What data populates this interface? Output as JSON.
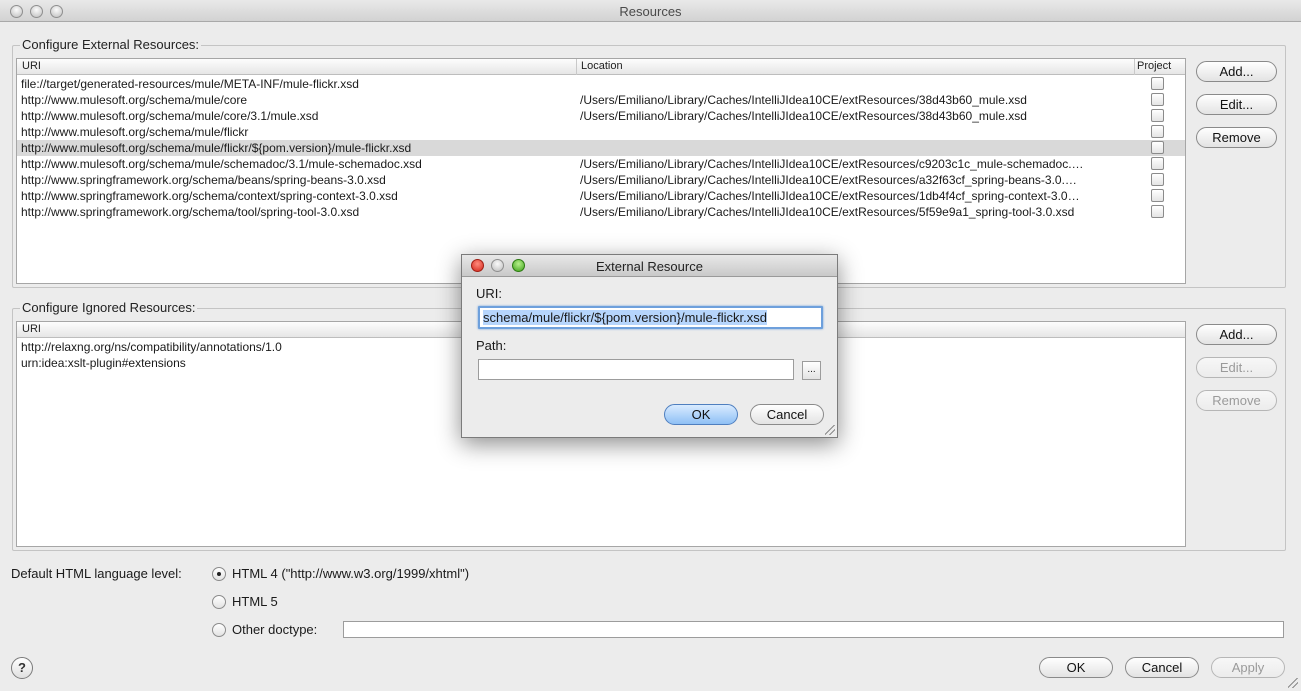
{
  "window": {
    "title": "Resources"
  },
  "external": {
    "group_label": "Configure External Resources:",
    "columns": {
      "uri": "URI",
      "location": "Location",
      "project": "Project"
    },
    "rows": [
      {
        "uri": "file://target/generated-resources/mule/META-INF/mule-flickr.xsd",
        "location": "",
        "project": false,
        "selected": false
      },
      {
        "uri": "http://www.mulesoft.org/schema/mule/core",
        "location": "/Users/Emiliano/Library/Caches/IntelliJIdea10CE/extResources/38d43b60_mule.xsd",
        "project": false,
        "selected": false
      },
      {
        "uri": "http://www.mulesoft.org/schema/mule/core/3.1/mule.xsd",
        "location": "/Users/Emiliano/Library/Caches/IntelliJIdea10CE/extResources/38d43b60_mule.xsd",
        "project": false,
        "selected": false
      },
      {
        "uri": "http://www.mulesoft.org/schema/mule/flickr",
        "location": "",
        "project": false,
        "selected": false
      },
      {
        "uri": "http://www.mulesoft.org/schema/mule/flickr/${pom.version}/mule-flickr.xsd",
        "location": "",
        "project": false,
        "selected": true
      },
      {
        "uri": "http://www.mulesoft.org/schema/mule/schemadoc/3.1/mule-schemadoc.xsd",
        "location": "/Users/Emiliano/Library/Caches/IntelliJIdea10CE/extResources/c9203c1c_mule-schemadoc.…",
        "project": false,
        "selected": false
      },
      {
        "uri": "http://www.springframework.org/schema/beans/spring-beans-3.0.xsd",
        "location": "/Users/Emiliano/Library/Caches/IntelliJIdea10CE/extResources/a32f63cf_spring-beans-3.0.…",
        "project": false,
        "selected": false
      },
      {
        "uri": "http://www.springframework.org/schema/context/spring-context-3.0.xsd",
        "location": "/Users/Emiliano/Library/Caches/IntelliJIdea10CE/extResources/1db4f4cf_spring-context-3.0…",
        "project": false,
        "selected": false
      },
      {
        "uri": "http://www.springframework.org/schema/tool/spring-tool-3.0.xsd",
        "location": "/Users/Emiliano/Library/Caches/IntelliJIdea10CE/extResources/5f59e9a1_spring-tool-3.0.xsd",
        "project": false,
        "selected": false
      }
    ],
    "buttons": {
      "add": "Add...",
      "edit": "Edit...",
      "remove": "Remove"
    }
  },
  "ignored": {
    "group_label": "Configure Ignored Resources:",
    "columns": {
      "uri": "URI"
    },
    "rows": [
      {
        "uri": "http://relaxng.org/ns/compatibility/annotations/1.0"
      },
      {
        "uri": "urn:idea:xslt-plugin#extensions"
      }
    ],
    "buttons": {
      "add": "Add...",
      "edit": "Edit...",
      "remove": "Remove"
    }
  },
  "html_level": {
    "label": "Default HTML language level:",
    "options": [
      {
        "label": "HTML 4 (\"http://www.w3.org/1999/xhtml\")",
        "checked": true
      },
      {
        "label": "HTML 5",
        "checked": false
      },
      {
        "label": "Other doctype:",
        "checked": false
      }
    ],
    "other_doctype_value": ""
  },
  "footer": {
    "help": "?",
    "ok": "OK",
    "cancel": "Cancel",
    "apply": "Apply"
  },
  "dialog": {
    "title": "External Resource",
    "uri_label": "URI:",
    "uri_value": "schema/mule/flickr/${pom.version}/mule-flickr.xsd",
    "path_label": "Path:",
    "path_value": "",
    "browse_label": "...",
    "ok": "OK",
    "cancel": "Cancel"
  },
  "icons": {
    "close": "close-icon",
    "minimize": "minimize-icon",
    "zoom": "zoom-icon",
    "browse": "ellipsis-icon",
    "resize": "resize-grip-icon",
    "help": "help-icon"
  },
  "colors": {
    "accent": "#6ea0dc",
    "selection": "#d9d9d9",
    "text_selection": "#b6d5fc"
  }
}
